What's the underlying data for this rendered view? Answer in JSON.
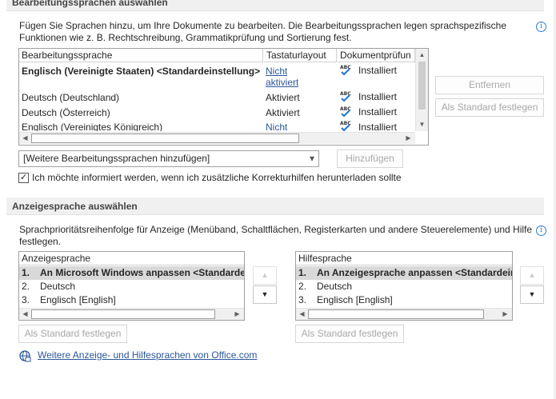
{
  "edit_section": {
    "title": "Bearbeitungssprachen auswählen",
    "description_line1": "Fügen Sie Sprachen hinzu, um Ihre Dokumente zu bearbeiten. Die Bearbeitungssprachen legen sprachspezifische",
    "description_line2": "Funktionen wie z. B. Rechtschreibung, Grammatikprüfung und Sortierung fest.",
    "columns": [
      "Bearbeitungssprache",
      "Tastaturlayout",
      "Dokumentprüfun"
    ],
    "rows": [
      {
        "language": "Englisch (Vereinigte Staaten) <Standardeinstellung>",
        "keyboard_line1": "Nicht",
        "keyboard_line2": "aktiviert",
        "keyboard_link": true,
        "proofing": "Installiert",
        "bold": true
      },
      {
        "language": "Deutsch (Deutschland)",
        "keyboard_line1": "Aktiviert",
        "keyboard_line2": "",
        "keyboard_link": false,
        "proofing": "Installiert",
        "bold": false
      },
      {
        "language": "Deutsch (Österreich)",
        "keyboard_line1": "Aktiviert",
        "keyboard_line2": "",
        "keyboard_link": false,
        "proofing": "Installiert",
        "bold": false
      },
      {
        "language": "Englisch (Vereinigtes Königreich)",
        "keyboard_line1": "Nicht",
        "keyboard_line2": "",
        "keyboard_link": true,
        "proofing": "Installiert",
        "bold": false
      }
    ],
    "remove_button": "Entfernen",
    "set_default_button": "Als Standard festlegen",
    "add_dropdown_value": "[Weitere Bearbeitungssprachen hinzufügen]",
    "add_button": "Hinzufügen",
    "notify_checkbox_label": "Ich möchte informiert werden, wenn ich zusätzliche Korrekturhilfen herunterladen sollte",
    "notify_checked": true
  },
  "display_section": {
    "title": "Anzeigesprache auswählen",
    "description_line1": "Sprachprioritätsreihenfolge für Anzeige (Menüband, Schaltflächen, Registerkarten und andere Steuerelemente) und Hilfe",
    "description_line2": "festlegen.",
    "display_list": {
      "header": "Anzeigesprache",
      "items": [
        {
          "num": "1.",
          "label": "An Microsoft Windows anpassen <Standardein"
        },
        {
          "num": "2.",
          "label": "Deutsch"
        },
        {
          "num": "3.",
          "label": "Englisch [English]"
        }
      ],
      "set_default_button": "Als Standard festlegen"
    },
    "help_list": {
      "header": "Hilfesprache",
      "items": [
        {
          "num": "1.",
          "label": "An Anzeigesprache anpassen <Standardeins"
        },
        {
          "num": "2.",
          "label": "Deutsch"
        },
        {
          "num": "3.",
          "label": "Englisch [English]"
        }
      ],
      "set_default_button": "Als Standard festlegen"
    },
    "office_link": "Weitere Anzeige- und Hilfesprachen von Office.com"
  },
  "icons": {
    "info": "info-icon",
    "proofing": "abc-check-icon",
    "arrow_up": "▲",
    "arrow_down": "▼",
    "arrow_left": "◀",
    "arrow_right": "▶",
    "dropdown": "▾",
    "checkmark": "✓",
    "info_glyph": "i",
    "abc_text": "ABC",
    "globe": "globe-icon"
  },
  "colors": {
    "link": "#2b579a",
    "check": "#2b7cd3",
    "section_bg": "#f0f0f0"
  }
}
